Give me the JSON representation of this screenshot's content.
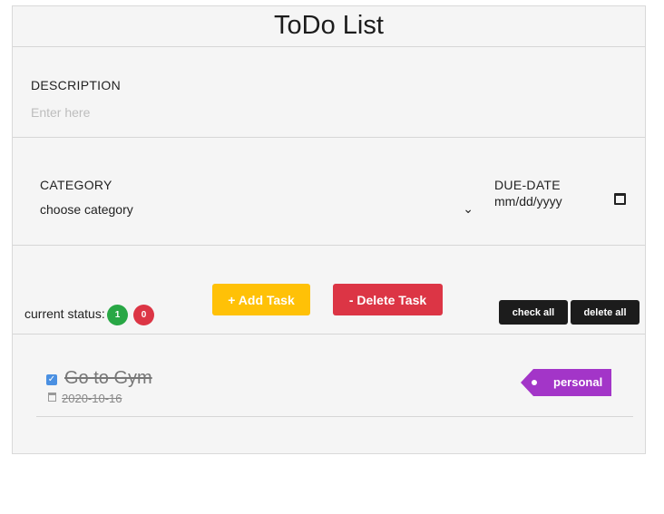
{
  "header": {
    "title": "ToDo List"
  },
  "description": {
    "label": "DESCRIPTION",
    "placeholder": "Enter here",
    "value": ""
  },
  "category": {
    "label": "CATEGORY",
    "selected": "choose category"
  },
  "due_date": {
    "label": "DUE-DATE",
    "placeholder": "mm/dd/yyyy"
  },
  "status": {
    "label": "current status:",
    "completed_count": "1",
    "pending_count": "0"
  },
  "actions": {
    "add_label": "+ Add Task",
    "delete_label": "- Delete Task",
    "check_all_label": "check all",
    "delete_all_label": "delete all"
  },
  "tasks": [
    {
      "name": "Go to Gym",
      "date": "2020-10-16",
      "category": "personal",
      "done": true,
      "tag_color": "#a335c8"
    }
  ],
  "colors": {
    "add": "#ffc107",
    "delete": "#dc3545",
    "completed_badge": "#28a745",
    "pending_badge": "#dc3545"
  }
}
